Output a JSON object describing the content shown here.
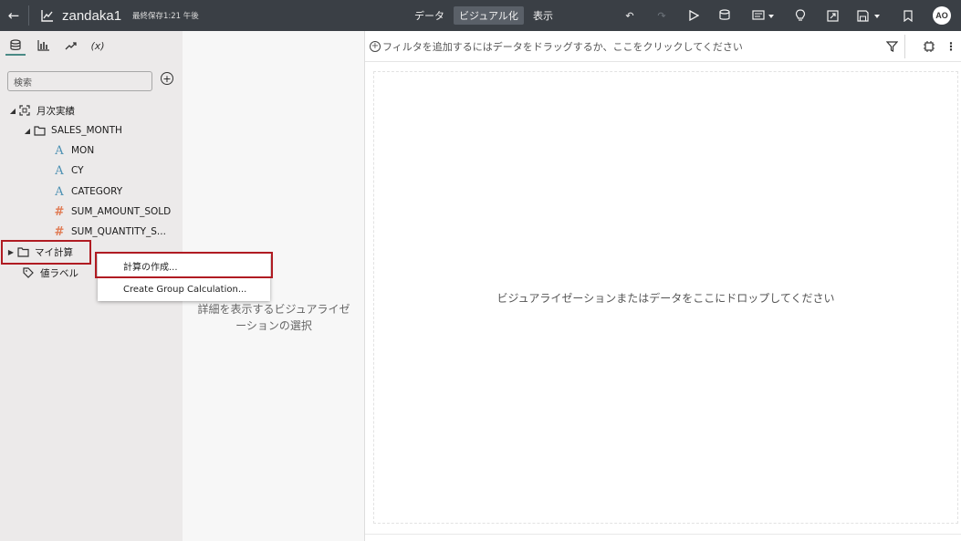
{
  "topbar": {
    "title": "zandaka1",
    "save_status": "最終保存1:21 午後",
    "tabs": [
      "データ",
      "ビジュアル化",
      "表示"
    ],
    "active_tab": "ビジュアル化",
    "avatar": "AO"
  },
  "left_panel": {
    "search_placeholder": "検索",
    "tree": {
      "root": "月次実績",
      "folder": "SALES_MONTH",
      "fields": [
        {
          "type": "attribute",
          "name": "MON"
        },
        {
          "type": "attribute",
          "name": "CY"
        },
        {
          "type": "attribute",
          "name": "CATEGORY"
        },
        {
          "type": "measure",
          "name": "SUM_AMOUNT_SOLD"
        },
        {
          "type": "measure",
          "name": "SUM_QUANTITY_S..."
        }
      ],
      "my_calculations": "マイ計算",
      "value_labels": "値ラベル"
    }
  },
  "context_menu": {
    "items": [
      "計算の作成...",
      "Create Group Calculation..."
    ]
  },
  "middle_panel": {
    "placeholder": "詳細を表示するビジュアライゼーションの選択"
  },
  "canvas": {
    "filter_hint": "フィルタを追加するにはデータをドラッグするか、ここをクリックしてください",
    "drop_hint": "ビジュアライゼーションまたはデータをここにドロップしてください"
  },
  "colors": {
    "topbar_bg": "#3a3f45",
    "highlight": "#b01b22",
    "attribute_icon": "#4a8fb2",
    "measure_icon": "#e07b54"
  }
}
